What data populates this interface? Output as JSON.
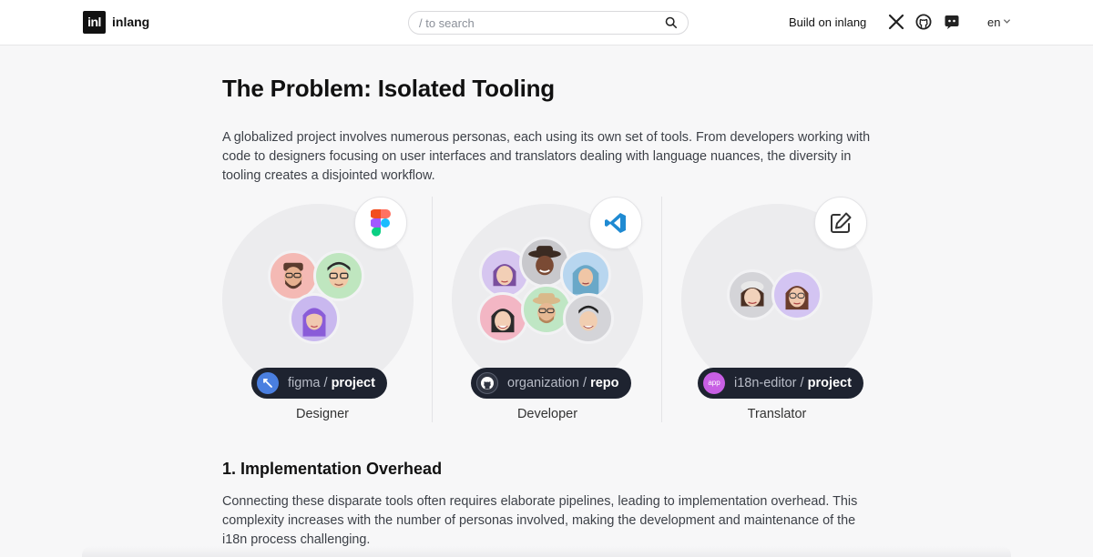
{
  "header": {
    "logo_mark": "inl",
    "logo_text": "inlang",
    "search_placeholder": "/ to search",
    "build_link": "Build on inlang",
    "language": "en",
    "icons": [
      "x-icon",
      "github-icon",
      "discord-icon"
    ]
  },
  "section1": {
    "title": "The Problem: Isolated Tooling",
    "paragraph": "A globalized project involves numerous personas, each using its own set of tools. From developers working with code to designers focusing on user interfaces and translators dealing with language nuances, the diversity in tooling creates a disjointed workflow."
  },
  "personas": [
    {
      "role": "Designer",
      "tool_icon": "figma-icon",
      "pill_source": "figma",
      "pill_sep": " / ",
      "pill_target": "project",
      "pill_icon_color": "#4a7fe0"
    },
    {
      "role": "Developer",
      "tool_icon": "vscode-icon",
      "pill_source": "organization",
      "pill_sep": " / ",
      "pill_target": "repo",
      "pill_icon_color": "#2f3441"
    },
    {
      "role": "Translator",
      "tool_icon": "pencil-edit-icon",
      "pill_source": "i18n-editor",
      "pill_sep": " / ",
      "pill_target": "project",
      "pill_icon_color": "#c85fe4",
      "pill_icon_text": "app"
    }
  ],
  "section2": {
    "title": "1. Implementation Overhead",
    "paragraph": "Connecting these disparate tools often requires elaborate pipelines, leading to implementation overhead. This complexity increases with the number of personas involved, making the development and maintenance of the i18n process challenging."
  },
  "colors": {
    "pill_bg": "#1e2330",
    "circle_bg": "#ececee",
    "page_bg": "#f7f7f8"
  }
}
